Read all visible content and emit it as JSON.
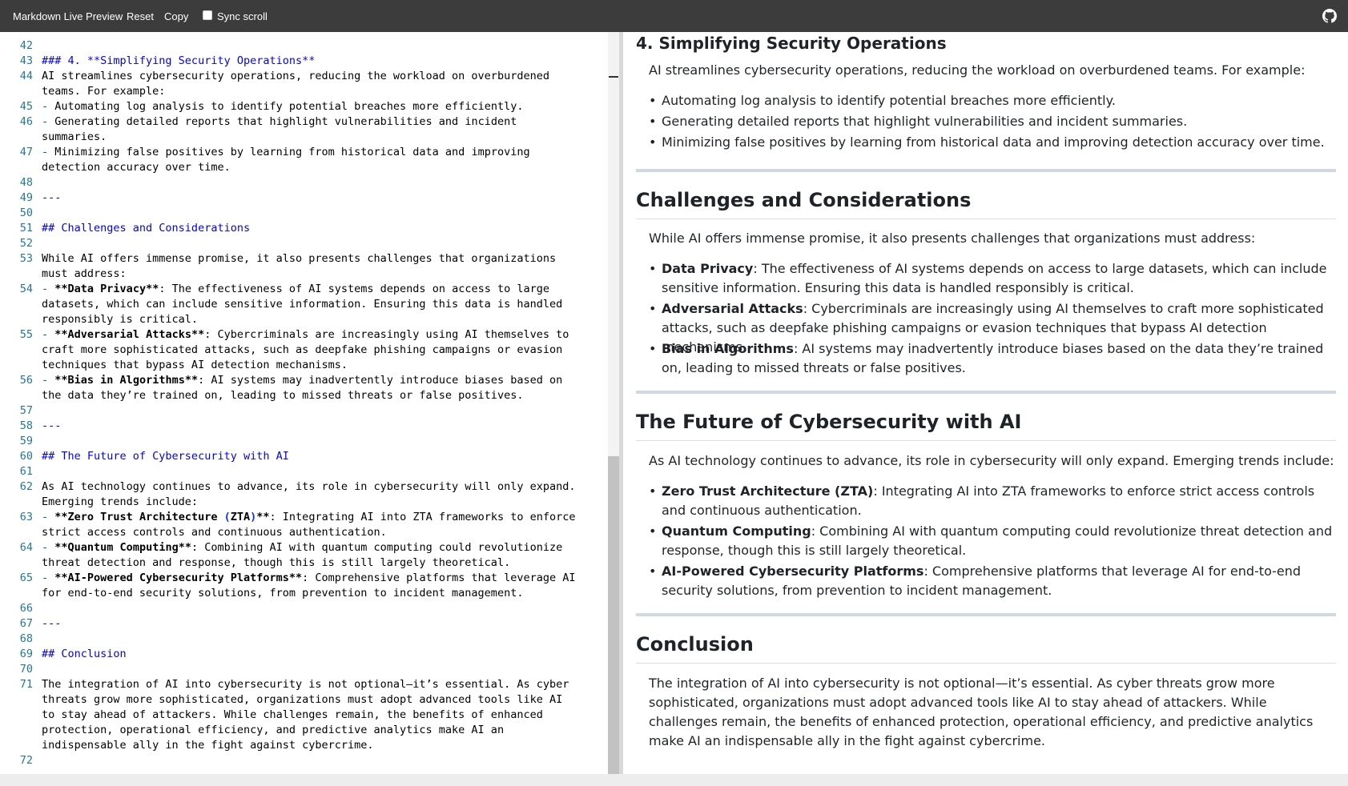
{
  "toolbar": {
    "title": "Markdown Live Preview",
    "reset_label": "Reset",
    "copy_label": "Copy",
    "sync_scroll_label": "Sync scroll",
    "sync_scroll_checked": false,
    "github_icon": "github-icon"
  },
  "editor": {
    "lines": [
      {
        "n": "42",
        "text": ""
      },
      {
        "n": "43",
        "text": "### 4. **Simplifying Security Operations**"
      },
      {
        "n": "44",
        "text": "AI streamlines cybersecurity operations, reducing the workload on overburdened"
      },
      {
        "n": "",
        "text": "teams. For example:"
      },
      {
        "n": "45",
        "text": "- Automating log analysis to identify potential breaches more efficiently."
      },
      {
        "n": "46",
        "text": "- Generating detailed reports that highlight vulnerabilities and incident"
      },
      {
        "n": "",
        "text": "summaries."
      },
      {
        "n": "47",
        "text": "- Minimizing false positives by learning from historical data and improving"
      },
      {
        "n": "",
        "text": "detection accuracy over time."
      },
      {
        "n": "48",
        "text": ""
      },
      {
        "n": "49",
        "text": "---"
      },
      {
        "n": "50",
        "text": ""
      },
      {
        "n": "51",
        "text": "## Challenges and Considerations"
      },
      {
        "n": "52",
        "text": ""
      },
      {
        "n": "53",
        "text": "While AI offers immense promise, it also presents challenges that organizations"
      },
      {
        "n": "",
        "text": "must address:"
      },
      {
        "n": "54",
        "text": "- **Data Privacy**: The effectiveness of AI systems depends on access to large"
      },
      {
        "n": "",
        "text": "datasets, which can include sensitive information. Ensuring this data is handled"
      },
      {
        "n": "",
        "text": "responsibly is critical."
      },
      {
        "n": "55",
        "text": "- **Adversarial Attacks**: Cybercriminals are increasingly using AI themselves to"
      },
      {
        "n": "",
        "text": "craft more sophisticated attacks, such as deepfake phishing campaigns or evasion"
      },
      {
        "n": "",
        "text": "techniques that bypass AI detection mechanisms."
      },
      {
        "n": "56",
        "text": "- **Bias in Algorithms**: AI systems may inadvertently introduce biases based on"
      },
      {
        "n": "",
        "text": "the data they’re trained on, leading to missed threats or false positives."
      },
      {
        "n": "57",
        "text": ""
      },
      {
        "n": "58",
        "text": "---"
      },
      {
        "n": "59",
        "text": ""
      },
      {
        "n": "60",
        "text": "## The Future of Cybersecurity with AI"
      },
      {
        "n": "61",
        "text": ""
      },
      {
        "n": "62",
        "text": "As AI technology continues to advance, its role in cybersecurity will only expand."
      },
      {
        "n": "",
        "text": "Emerging trends include:"
      },
      {
        "n": "63",
        "text": "- **Zero Trust Architecture (ZTA)**: Integrating AI into ZTA frameworks to enforce"
      },
      {
        "n": "",
        "text": "strict access controls and continuous authentication."
      },
      {
        "n": "64",
        "text": "- **Quantum Computing**: Combining AI with quantum computing could revolutionize"
      },
      {
        "n": "",
        "text": "threat detection and response, though this is still largely theoretical."
      },
      {
        "n": "65",
        "text": "- **AI-Powered Cybersecurity Platforms**: Comprehensive platforms that leverage AI"
      },
      {
        "n": "",
        "text": "for end-to-end security solutions, from prevention to incident management."
      },
      {
        "n": "66",
        "text": ""
      },
      {
        "n": "67",
        "text": "---"
      },
      {
        "n": "68",
        "text": ""
      },
      {
        "n": "69",
        "text": "## Conclusion"
      },
      {
        "n": "70",
        "text": ""
      },
      {
        "n": "71",
        "text": "The integration of AI into cybersecurity is not optional—it’s essential. As cyber"
      },
      {
        "n": "",
        "text": "threats grow more sophisticated, organizations must adopt advanced tools like AI"
      },
      {
        "n": "",
        "text": "to stay ahead of attackers. While challenges remain, the benefits of enhanced"
      },
      {
        "n": "",
        "text": "protection, operational efficiency, and predictive analytics make AI an"
      },
      {
        "n": "",
        "text": "indispensable ally in the fight against cybercrime."
      },
      {
        "n": "72",
        "text": ""
      }
    ]
  },
  "preview": {
    "section1": {
      "heading": "4. Simplifying Security Operations",
      "intro": "AI streamlines cybersecurity operations, reducing the workload on overburdened teams. For example:",
      "items": [
        {
          "bold": "",
          "text": "Automating log analysis to identify potential breaches more efficiently."
        },
        {
          "bold": "",
          "text": "Generating detailed reports that highlight vulnerabilities and incident summaries."
        },
        {
          "bold": "",
          "text": "Minimizing false positives by learning from historical data and improving detection accuracy over time."
        }
      ]
    },
    "section2": {
      "heading": "Challenges and Considerations",
      "intro": "While AI offers immense promise, it also presents challenges that organizations must address:",
      "items": [
        {
          "bold": "Data Privacy",
          "text": ": The effectiveness of AI systems depends on access to large datasets, which can include sensitive information. Ensuring this data is handled responsibly is critical."
        },
        {
          "bold": "Adversarial Attacks",
          "text": ": Cybercriminals are increasingly using AI themselves to craft more sophisticated attacks, such as deepfake phishing campaigns or evasion techniques that bypass AI detection mechanisms."
        },
        {
          "bold": "Bias in Algorithms",
          "text": ": AI systems may inadvertently introduce biases based on the data they’re trained on, leading to missed threats or false positives."
        }
      ]
    },
    "section3": {
      "heading": "The Future of Cybersecurity with AI",
      "intro": "As AI technology continues to advance, its role in cybersecurity will only expand. Emerging trends include:",
      "items": [
        {
          "bold": "Zero Trust Architecture (ZTA)",
          "text": ": Integrating AI into ZTA frameworks to enforce strict access controls and continuous authentication."
        },
        {
          "bold": "Quantum Computing",
          "text": ": Combining AI with quantum computing could revolutionize threat detection and response, though this is still largely theoretical."
        },
        {
          "bold": "AI-Powered Cybersecurity Platforms",
          "text": ": Comprehensive platforms that leverage AI for end-to-end security solutions, from prevention to incident management."
        }
      ]
    },
    "section4": {
      "heading": "Conclusion",
      "intro": "The integration of AI into cybersecurity is not optional—it’s essential. As cyber threats grow more sophisticated, organizations must adopt advanced tools like AI to stay ahead of attackers. While challenges remain, the benefits of enhanced protection, operational efficiency, and predictive analytics make AI an indispensable ally in the fight against cybercrime."
    }
  }
}
